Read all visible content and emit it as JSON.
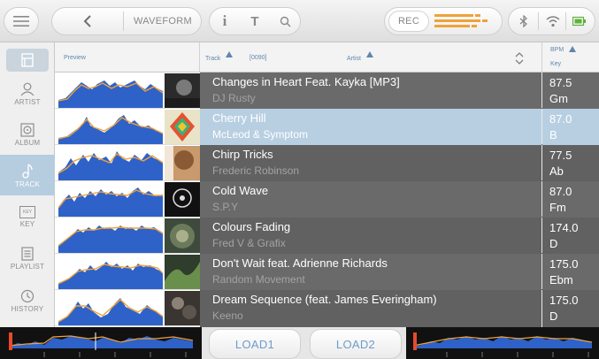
{
  "topbar": {
    "waveform_label": "WAVEFORM",
    "rec_label": "REC",
    "info_glyph": "i",
    "filter_glyph": "T",
    "icons": [
      "menu-icon",
      "chevron-left-icon",
      "info-icon",
      "filter-icon",
      "search-icon",
      "bluetooth-icon",
      "wifi-icon",
      "battery-icon"
    ]
  },
  "sidebar": {
    "items": [
      {
        "label": "ARTIST",
        "icon": "person-icon",
        "active": false
      },
      {
        "label": "ALBUM",
        "icon": "album-icon",
        "active": false
      },
      {
        "label": "TRACK",
        "icon": "music-note-icon",
        "active": true
      },
      {
        "label": "KEY",
        "icon": "key-icon",
        "active": false
      },
      {
        "label": "PLAYLIST",
        "icon": "playlist-icon",
        "active": false
      },
      {
        "label": "HISTORY",
        "icon": "history-icon",
        "active": false
      }
    ]
  },
  "headers": {
    "preview": "Preview",
    "track": "Track",
    "count": "[0090]",
    "artist": "Artist",
    "bpm": "BPM",
    "key": "Key"
  },
  "tracks": [
    {
      "title": "Changes in Heart Feat. Kayka [MP3]",
      "artist": "DJ Rusty",
      "bpm": "87.5",
      "key": "Gm",
      "selected": false
    },
    {
      "title": "Cherry Hill",
      "artist": "McLeod & Symptom",
      "bpm": "87.0",
      "key": "B",
      "selected": true
    },
    {
      "title": "Chirp Tricks",
      "artist": "Frederic Robinson",
      "bpm": "77.5",
      "key": "Ab",
      "selected": false
    },
    {
      "title": "Cold Wave",
      "artist": "S.P.Y",
      "bpm": "87.0",
      "key": "Fm",
      "selected": false
    },
    {
      "title": "Colours Fading",
      "artist": "Fred V & Grafix",
      "bpm": "174.0",
      "key": "D",
      "selected": false
    },
    {
      "title": "Don't Wait feat. Adrienne Richards",
      "artist": "Random Movement",
      "bpm": "175.0",
      "key": "Ebm",
      "selected": false
    },
    {
      "title": "Dream Sequence (feat. James Everingham)",
      "artist": "Keeno",
      "bpm": "175.0",
      "key": "D",
      "selected": false
    }
  ],
  "bottom": {
    "load1": "LOAD1",
    "load2": "LOAD2"
  },
  "colors": {
    "accent_blue": "#5f86ad",
    "selected_row": "#b8cfe2",
    "row_bg": "#6a6a6a",
    "wave_blue": "#2f62c8",
    "wave_orange": "#f0a23a",
    "rec_meter": "#f0a23a"
  }
}
